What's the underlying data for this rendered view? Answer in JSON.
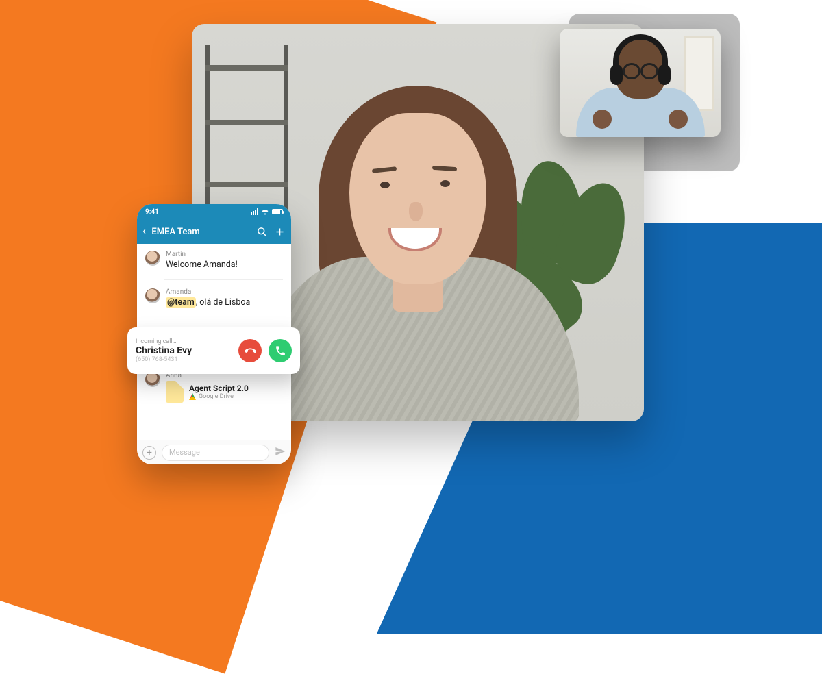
{
  "colors": {
    "orange": "#f47920",
    "blue": "#1268b3",
    "brand": "#1c8ab8",
    "decline": "#e74c3c",
    "accept": "#2ecc71"
  },
  "phone": {
    "status_time": "9:41",
    "back_label": "‹",
    "team_title": "EMEA Team",
    "search_icon": "search",
    "add_icon": "plus",
    "messages": [
      {
        "name": "Martin",
        "text_plain": "Welcome Amanda!"
      },
      {
        "name": "Amanda",
        "mention": "@team",
        "text_rest": ", olá de Lisboa"
      },
      {
        "name": "Anna",
        "file": {
          "title": "Agent Script 2.0",
          "source": "Google Drive"
        }
      }
    ],
    "composer": {
      "placeholder": "Message",
      "plus_icon": "add",
      "send_icon": "send"
    }
  },
  "incoming_call": {
    "label": "Incoming call…",
    "name": "Christina Evy",
    "number": "(650) 768-5431",
    "decline_icon": "phone-down",
    "accept_icon": "phone"
  },
  "video": {
    "main_label": "main-participant",
    "pip_label": "pip-participant"
  }
}
